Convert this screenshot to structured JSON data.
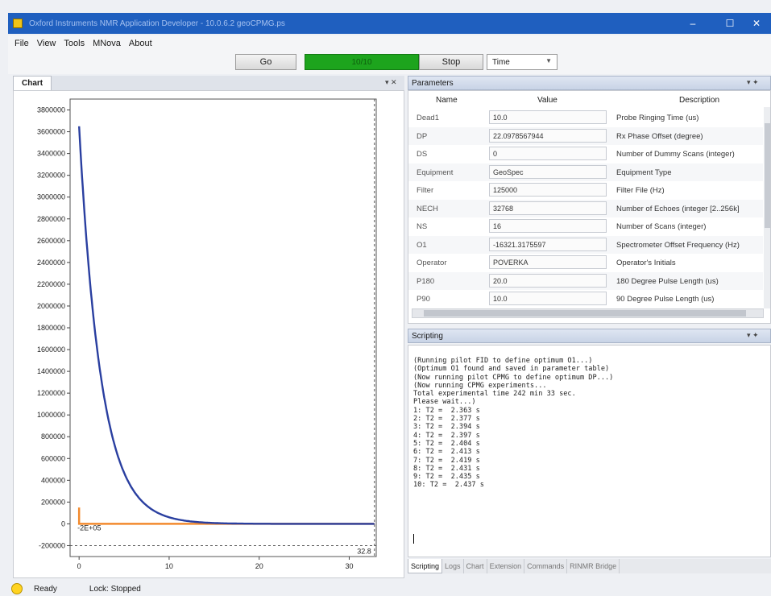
{
  "window": {
    "title": "Oxford Instruments NMR Application Developer - 10.0.6.2 geoCPMG.ps",
    "minimize_glyph": "–",
    "maximize_glyph": "☐",
    "close_glyph": "✕"
  },
  "menu": [
    "File",
    "View",
    "Tools",
    "MNova",
    "About"
  ],
  "toolbar": {
    "go_label": "Go",
    "status_label": "10/10",
    "stop_label": "Stop",
    "view_select": "Time"
  },
  "chart_panel": {
    "tab_label": "Chart"
  },
  "chart_data": {
    "type": "line",
    "title": "",
    "xlabel": "",
    "ylabel": "",
    "xlim": [
      -1,
      33
    ],
    "ylim": [
      -300000,
      3900000
    ],
    "x_ticks": [
      "0",
      "10",
      "20",
      "30"
    ],
    "y_ticks": [
      "3800000",
      "3600000",
      "3400000",
      "3200000",
      "3000000",
      "2800000",
      "2600000",
      "2400000",
      "2200000",
      "2000000",
      "1800000",
      "1600000",
      "1400000",
      "1200000",
      "1000000",
      "800000",
      "600000",
      "400000",
      "200000",
      "0",
      "-200000"
    ],
    "annotations": [
      "-2E+05",
      "32.8"
    ],
    "series": [
      {
        "color": "#2a3fa0",
        "t0": 0,
        "y0": 3650000,
        "T2": 2.437,
        "t_end": 32.8
      },
      {
        "color": "#f28a2e",
        "x": [
          0,
          0,
          0.2,
          32.8
        ],
        "y": [
          150000,
          0,
          0,
          0
        ]
      }
    ]
  },
  "parameters": {
    "header": "Parameters",
    "columns": [
      "Name",
      "Value",
      "Description"
    ],
    "rows": [
      {
        "name": "Dead1",
        "value": "10.0",
        "desc": "Probe Ringing Time (us)"
      },
      {
        "name": "DP",
        "value": "22.0978567944",
        "desc": "Rx Phase Offset (degree)"
      },
      {
        "name": "DS",
        "value": "0",
        "desc": "Number of Dummy Scans (integer)"
      },
      {
        "name": "Equipment",
        "value": "GeoSpec",
        "desc": "Equipment Type"
      },
      {
        "name": "Filter",
        "value": "125000",
        "desc": "Filter File (Hz)"
      },
      {
        "name": "NECH",
        "value": "32768",
        "desc": "Number of Echoes (integer [2..256k]"
      },
      {
        "name": "NS",
        "value": "16",
        "desc": "Number of Scans (integer)"
      },
      {
        "name": "O1",
        "value": "-16321.3175597",
        "desc": "Spectrometer Offset Frequency (Hz)"
      },
      {
        "name": "Operator",
        "value": "POVERKA",
        "desc": "Operator's Initials"
      },
      {
        "name": "P180",
        "value": "20.0",
        "desc": "180 Degree Pulse Length (us)"
      },
      {
        "name": "P90",
        "value": "10.0",
        "desc": "90 Degree Pulse Length (us)"
      }
    ]
  },
  "scripting": {
    "header": "Scripting",
    "console_lines": [
      "(Running pilot FID to define optimum O1...)",
      "(Optimum O1 found and saved in parameter table)",
      "(Now running pilot CPMG to define optimum DP...)",
      "(Now running CPMG experiments...",
      "Total experimental time 242 min 33 sec.",
      "Please wait...)",
      "1: T2 =  2.363 s",
      "2: T2 =  2.377 s",
      "3: T2 =  2.394 s",
      "4: T2 =  2.397 s",
      "5: T2 =  2.404 s",
      "6: T2 =  2.413 s",
      "7: T2 =  2.419 s",
      "8: T2 =  2.431 s",
      "9: T2 =  2.435 s",
      "10: T2 =  2.437 s"
    ],
    "tabs": [
      "Scripting",
      "Logs",
      "Chart",
      "Extension",
      "Commands",
      "RINMR Bridge"
    ]
  },
  "status": {
    "ready": "Ready",
    "lock": "Lock: Stopped"
  }
}
